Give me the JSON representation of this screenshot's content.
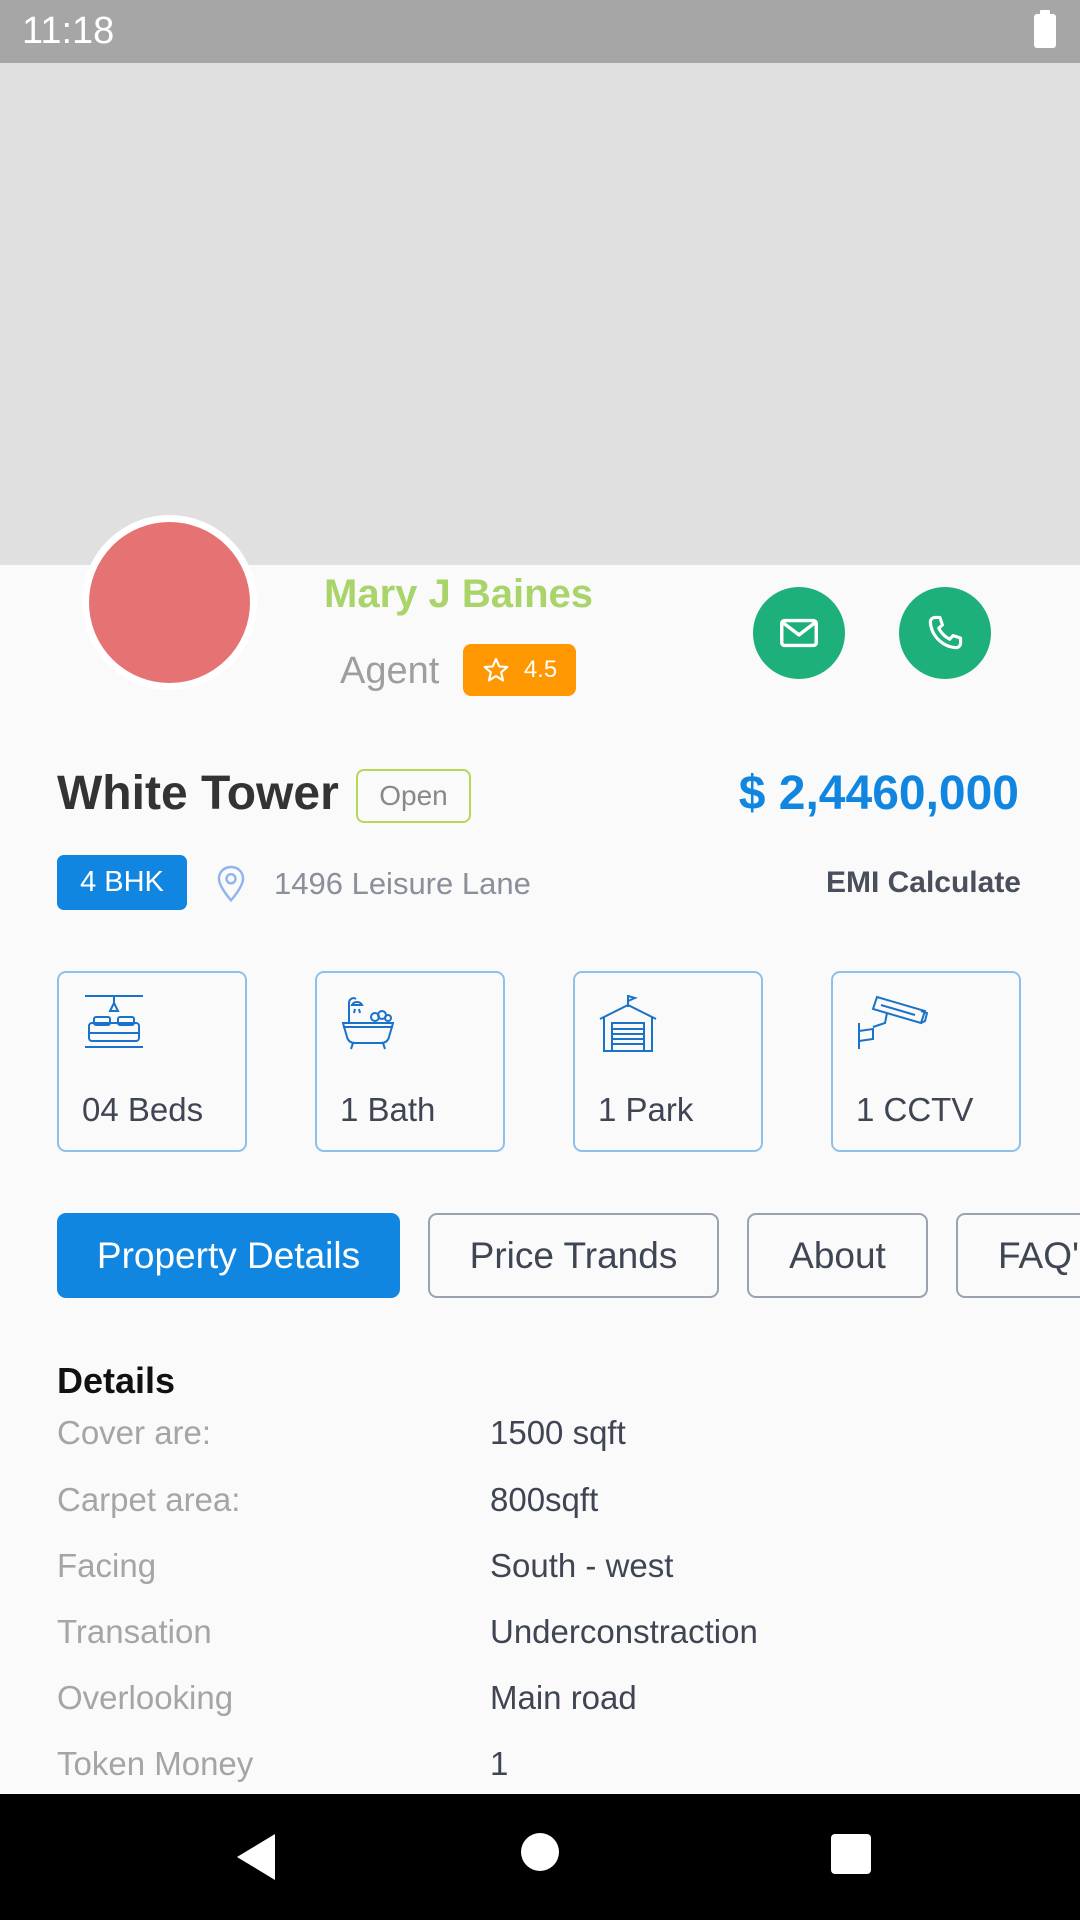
{
  "status_bar": {
    "time": "11:18"
  },
  "agent": {
    "name": "Mary J Baines",
    "role": "Agent",
    "rating": "4.5"
  },
  "property": {
    "title": "White Tower",
    "status": "Open",
    "price": "$ 2,4460,000",
    "bhk": "4 BHK",
    "address": "1496  Leisure Lane",
    "emi_label": "EMI Calculate"
  },
  "amenities": [
    {
      "icon": "bed-icon",
      "label": "04 Beds"
    },
    {
      "icon": "bathtub-icon",
      "label": "1 Bath"
    },
    {
      "icon": "garage-icon",
      "label": "1 Park"
    },
    {
      "icon": "cctv-camera-icon",
      "label": "1 CCTV"
    }
  ],
  "tabs": [
    {
      "label": "Property Details",
      "active": true
    },
    {
      "label": "Price Trands",
      "active": false
    },
    {
      "label": "About",
      "active": false
    },
    {
      "label": "FAQ's",
      "active": false
    }
  ],
  "details": {
    "title": "Details",
    "rows": [
      {
        "label": "Cover are:",
        "value": "1500 sqft"
      },
      {
        "label": "Carpet area:",
        "value": "800sqft"
      },
      {
        "label": "Facing",
        "value": "South - west"
      },
      {
        "label": "Transation",
        "value": "Underconstraction"
      },
      {
        "label": "Overlooking",
        "value": "Main road"
      },
      {
        "label": "Token Money",
        "value": "1"
      }
    ]
  },
  "colors": {
    "accent": "#1186e0",
    "agent_name": "#a9d46a",
    "rating": "#ff9800",
    "contact_buttons": "#1db07a",
    "avatar": "#e57373"
  }
}
